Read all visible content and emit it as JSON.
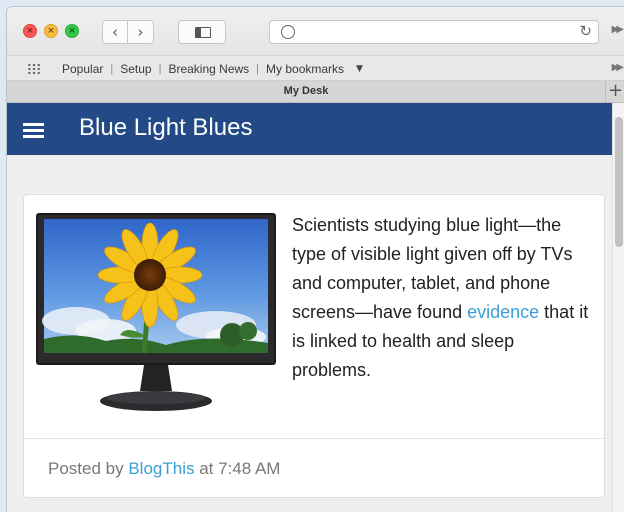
{
  "browser": {
    "url": "",
    "bookmarks": [
      "Popular",
      "Setup",
      "Breaking News",
      "My bookmarks"
    ],
    "tab_title": "My Desk",
    "new_tab_label": "+"
  },
  "blog": {
    "title": "Blue Light Blues",
    "post": {
      "text_before": "Scientists studying blue light—the type of visible light given off by TVs and computer, tablet, and phone screens—have found ",
      "link_text": "evidence",
      "text_after": " that it is linked to health and sleep problems.",
      "footer_prefix": "Posted by ",
      "author": "BlogThis",
      "footer_mid": " at ",
      "time": "7:48 AM"
    }
  },
  "colors": {
    "appbar": "#234a86",
    "link": "#3a9fd6",
    "close": "#fc5753",
    "minimize": "#fdbc40",
    "zoom": "#33c748"
  }
}
